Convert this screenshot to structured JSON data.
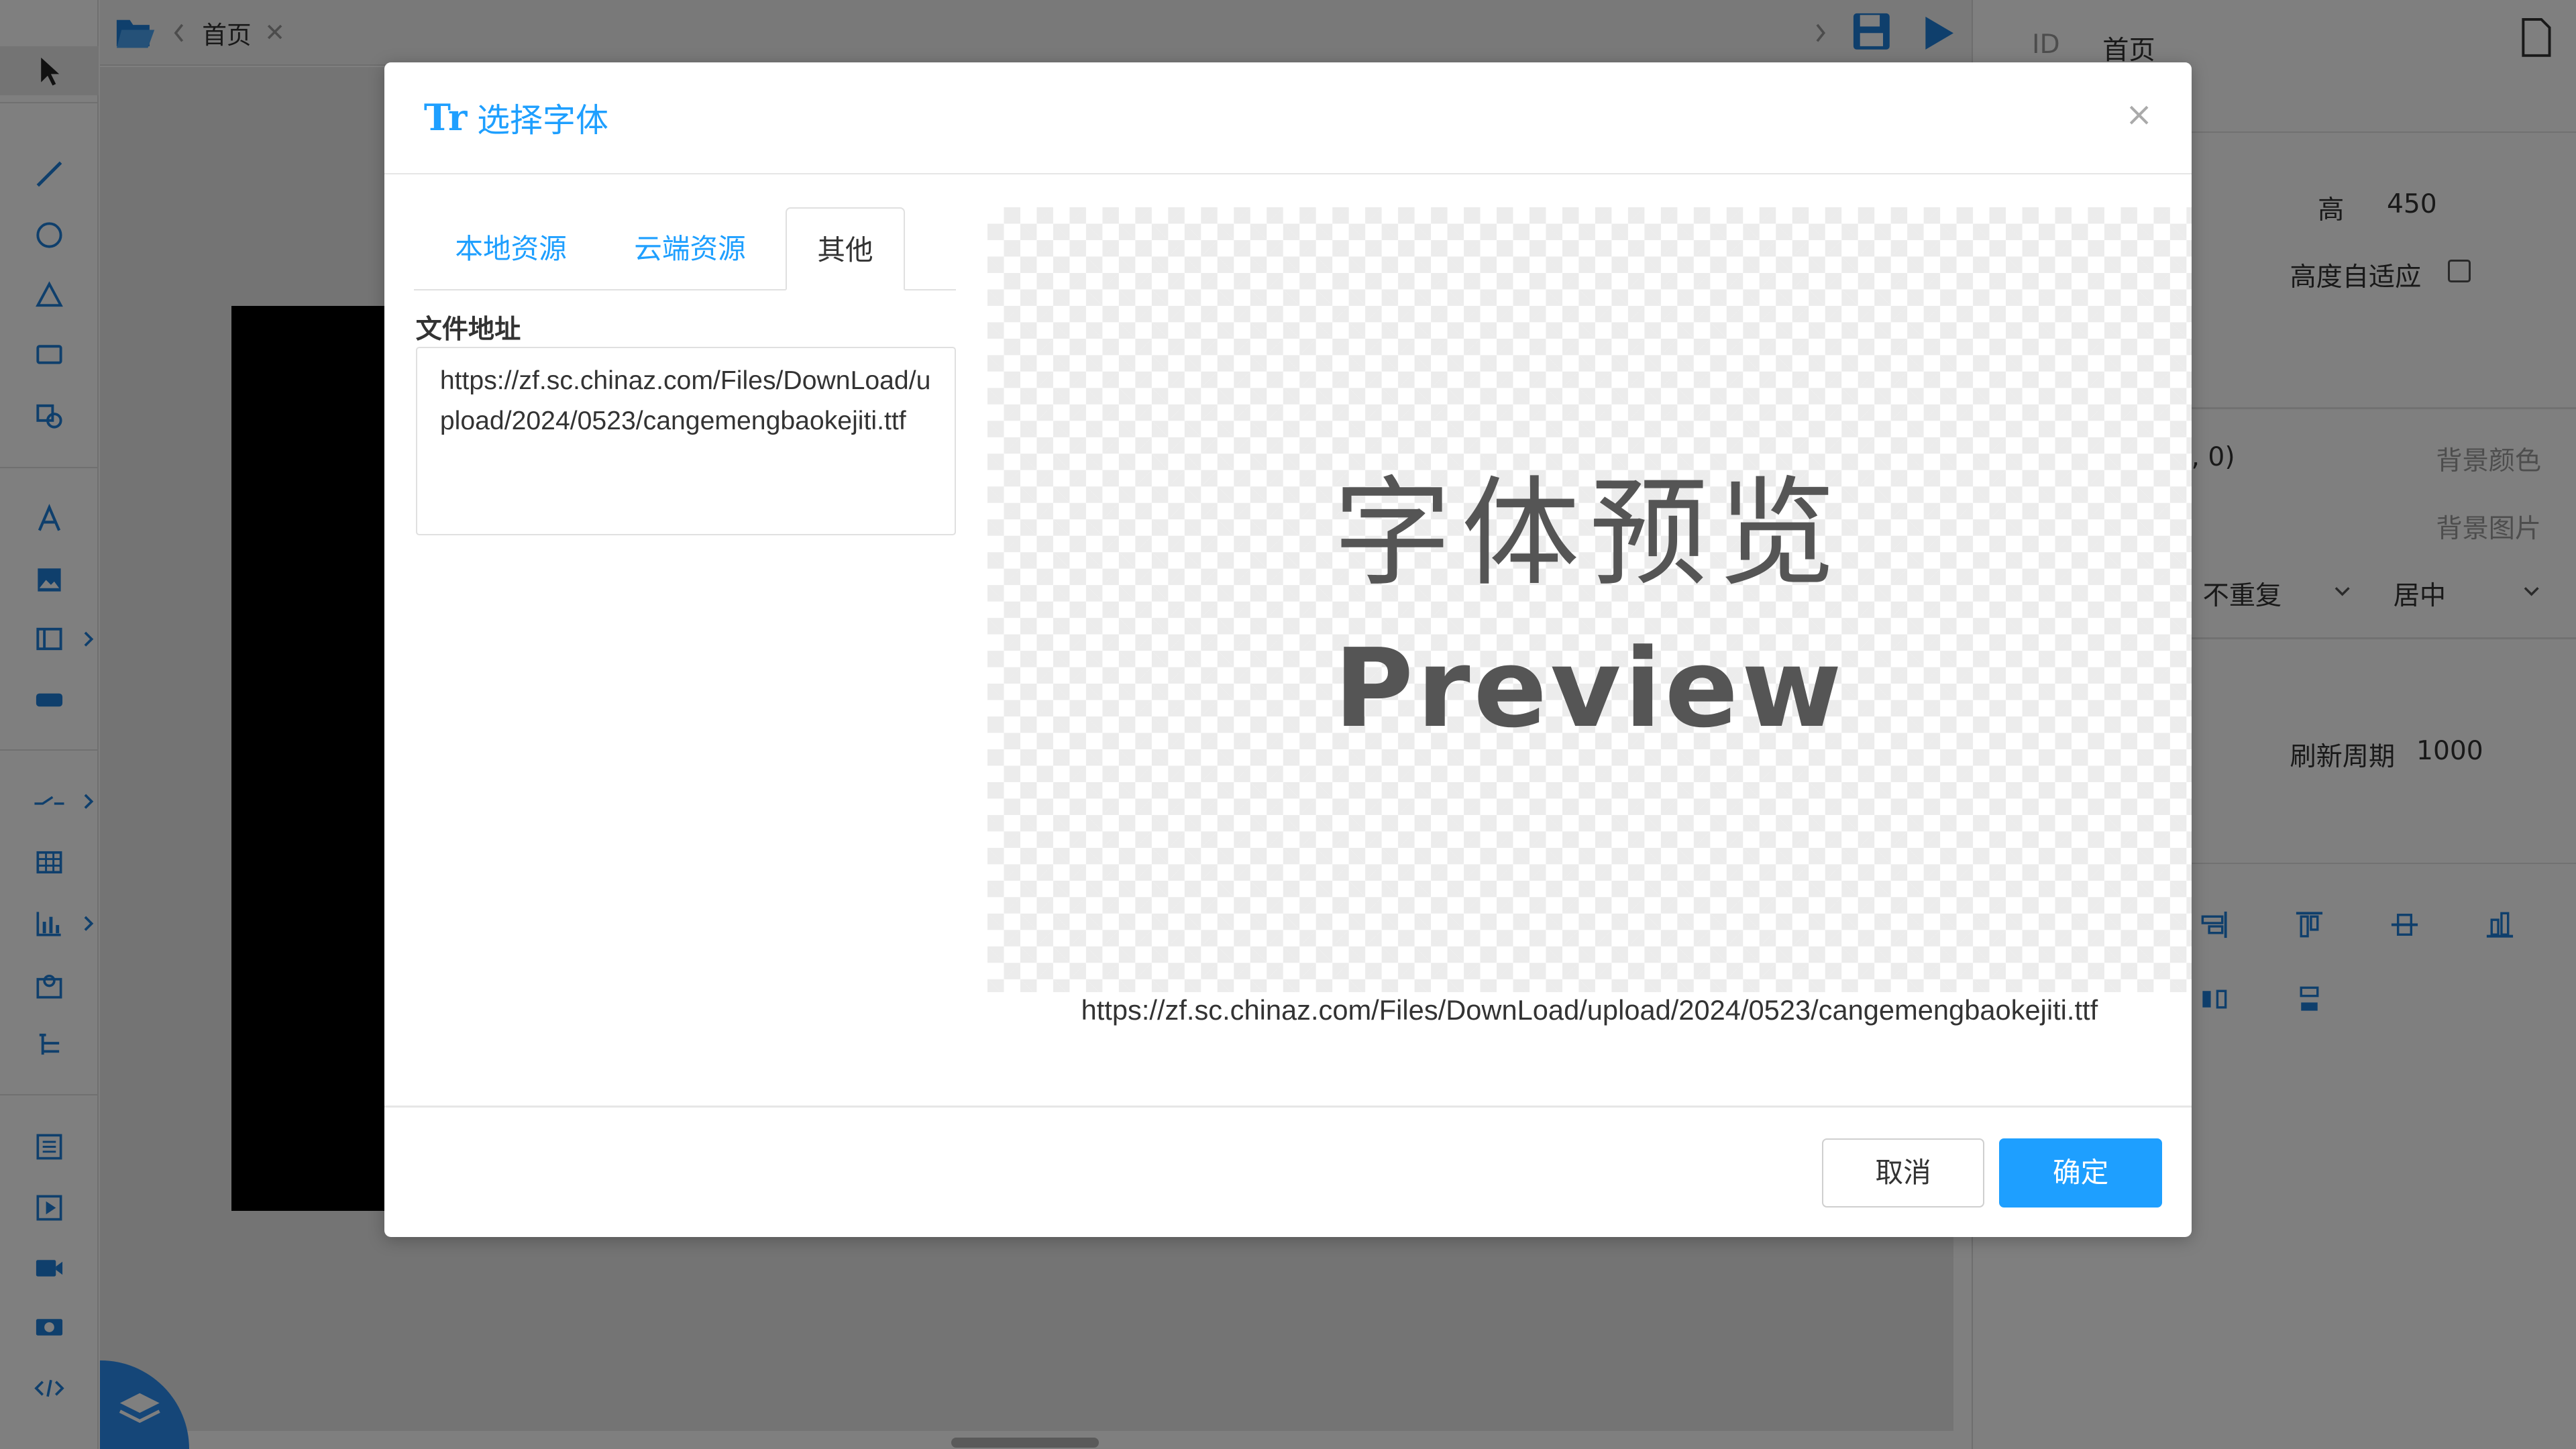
{
  "editor": {
    "tab_label": "首页",
    "right_panel": {
      "id_label": "ID",
      "id_value": "首页",
      "height_label": "高",
      "height_value": "450",
      "auto_height_label": "高度自适应",
      "bg_color_value": ", 0)",
      "bg_color_label": "背景颜色",
      "bg_image_label": "背景图片",
      "repeat_value": "不重复",
      "align_value": "居中",
      "refresh_label": "刷新周期",
      "refresh_value": "1000"
    }
  },
  "dialog": {
    "title_icon": "Tr",
    "title": "选择字体",
    "close_glyph": "×",
    "tabs": [
      {
        "label": "本地资源",
        "active": false
      },
      {
        "label": "云端资源",
        "active": false
      },
      {
        "label": "其他",
        "active": true
      }
    ],
    "field_label": "文件地址",
    "url_value": "https://zf.sc.chinaz.com/Files/DownLoad/upload/2024/0523/cangemengbaokejiti.ttf",
    "preview_text_cn": "字体预览",
    "preview_text_en": "Preview",
    "preview_url": "https://zf.sc.chinaz.com/Files/DownLoad/upload/2024/0523/cangemengbaokejiti.ttf",
    "cancel_label": "取消",
    "ok_label": "确定"
  },
  "colors": {
    "accent": "#1e9fff",
    "mask": "rgba(0,0,0,0.5)"
  }
}
